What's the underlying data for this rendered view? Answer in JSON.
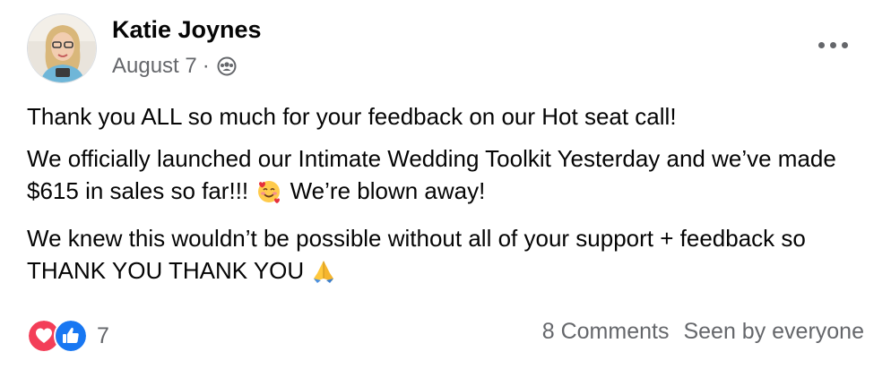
{
  "post": {
    "author": "Katie Joynes",
    "date": "August 7",
    "separator": "·",
    "audience_icon": "group-icon",
    "more_icon": "more-options-icon",
    "paragraphs": {
      "p1": "Thank you ALL so much for your feedback on our Hot seat call!",
      "p2a": "We officially launched our Intimate Wedding Toolkit Yesterday and we’ve made $615 in sales so far!!!",
      "p2b": "We’re blown away!",
      "p3": "We knew this wouldn’t be possible without all of your support + feedback so THANK YOU THANK YOU"
    },
    "emojis": [
      "smiling-face-with-hearts-emoji",
      "folded-hands-emoji"
    ],
    "reactions": {
      "types": [
        "love",
        "like"
      ],
      "count": "7"
    },
    "comments_label": "8 Comments",
    "seen_label": "Seen by everyone",
    "colors": {
      "love": "#f33e58",
      "like": "#1877f2",
      "secondary_text": "#65676b"
    }
  }
}
